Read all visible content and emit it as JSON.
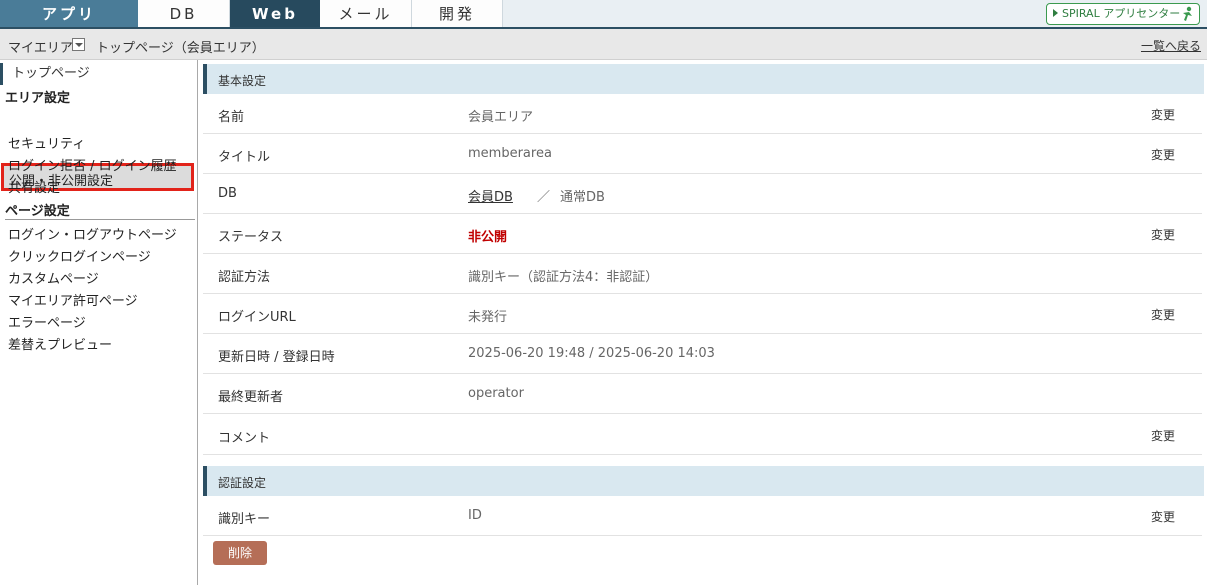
{
  "tabs": [
    {
      "label": "アプリ"
    },
    {
      "label": "DB"
    },
    {
      "label": "Web"
    },
    {
      "label": "メール"
    },
    {
      "label": "開発"
    }
  ],
  "app_center_label": "SPIRAL アプリセンター",
  "breadcrumb": {
    "myarea": "マイエリア",
    "page": "トップページ（会員エリア）",
    "back": "一覧へ戻る"
  },
  "sidebar": {
    "top": "トップページ",
    "area_heading": "エリア設定",
    "area_items": [
      "公開・非公開設定",
      "セキュリティ",
      "ログイン拒否 / ログイン履歴",
      "共有設定"
    ],
    "page_heading": "ページ設定",
    "page_items": [
      "ログイン・ログアウトページ",
      "クリックログインページ",
      "カスタムページ",
      "マイエリア許可ページ",
      "エラーページ",
      "差替えプレビュー"
    ]
  },
  "basic": {
    "heading": "基本設定",
    "change": "変更",
    "rows": [
      {
        "key": "名前",
        "value": "会員エリア"
      },
      {
        "key": "タイトル",
        "value": "memberarea"
      },
      {
        "key": "DB",
        "db_link": "会員DB",
        "sep": "／",
        "db_type": "通常DB"
      },
      {
        "key": "ステータス",
        "value": "非公開"
      },
      {
        "key": "認証方法",
        "value": "識別キー（認証方法4：非認証）"
      },
      {
        "key": "ログインURL",
        "value": "未発行"
      },
      {
        "key": "更新日時 / 登録日時",
        "value": "2025-06-20 19:48 / 2025-06-20 14:03"
      },
      {
        "key": "最終更新者",
        "value": "operator"
      },
      {
        "key": "コメント",
        "value": ""
      }
    ]
  },
  "auth": {
    "heading": "認証設定",
    "rows": [
      {
        "key": "識別キー",
        "value": "ID"
      }
    ]
  },
  "delete_label": "削除",
  "colors": {
    "accent": "#2c4f63",
    "section_bg": "#d9e8f0",
    "status_red": "#c00000",
    "delete_btn": "#b56e57",
    "highlight_border": "#e2231a"
  }
}
